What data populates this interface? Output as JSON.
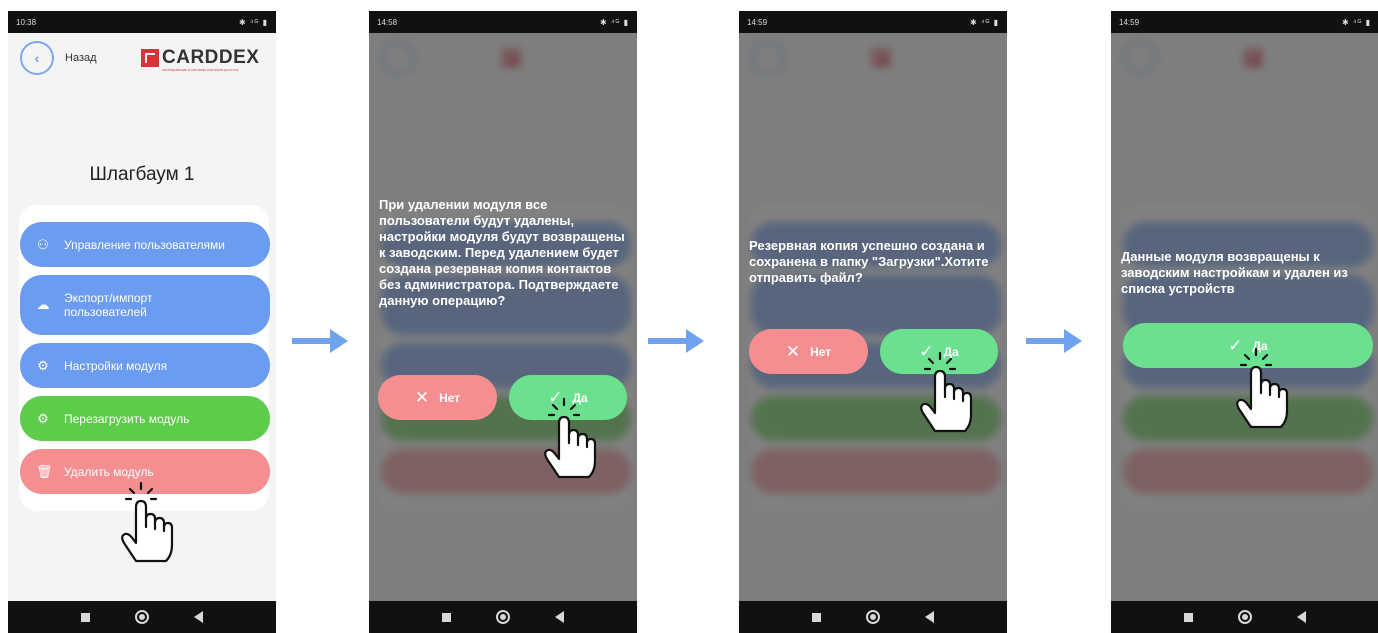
{
  "status_bar": [
    {
      "time": "10:38",
      "icons_right": "✱ ⁴ᴳ ▮"
    },
    {
      "time": "14:58",
      "icons_right": "✱ ⁴ᴳ ▮"
    },
    {
      "time": "14:59",
      "icons_right": "✱ ⁴ᴳ ▮"
    },
    {
      "time": "14:59",
      "icons_right": "✱ ⁴ᴳ ▮"
    }
  ],
  "header": {
    "back_label": "Назад",
    "logo_text": "CARDDEX",
    "logo_tagline": "ОБОРУДОВАНИЕ И СИСТЕМЫ КОНТРОЛЯ ДОСТУПА"
  },
  "device_title": "Шлагбаум 1",
  "menu": {
    "manage_users": "Управление пользователями",
    "export_import": "Экспорт/импорт пользователей",
    "module_settings": "Настройки модуля",
    "reboot_module": "Перезагрузить модуль",
    "delete_module": "Удалить модуль"
  },
  "dialogs": {
    "confirm_delete": "При удалении модуля все пользователи будут удалены, настройки модуля будут возвращены к заводским. Перед удалением будет создана резервная копия контактов без администратора. Подтверждаете данную операцию?",
    "backup_saved": "Резервная копия успешно создана и сохранена в папку \"Загрузки\".Хотите отправить файл?",
    "module_reset": "Данные модуля возвращены к заводским настройкам и удален из списка устройств"
  },
  "buttons": {
    "no": "Нет",
    "yes": "Да"
  },
  "colors": {
    "blue_button": "#6b9cf0",
    "green_button": "#5ccc4a",
    "red_button": "#f58e91",
    "confirm_green": "#6be08f",
    "arrow": "#6fa3ee"
  }
}
